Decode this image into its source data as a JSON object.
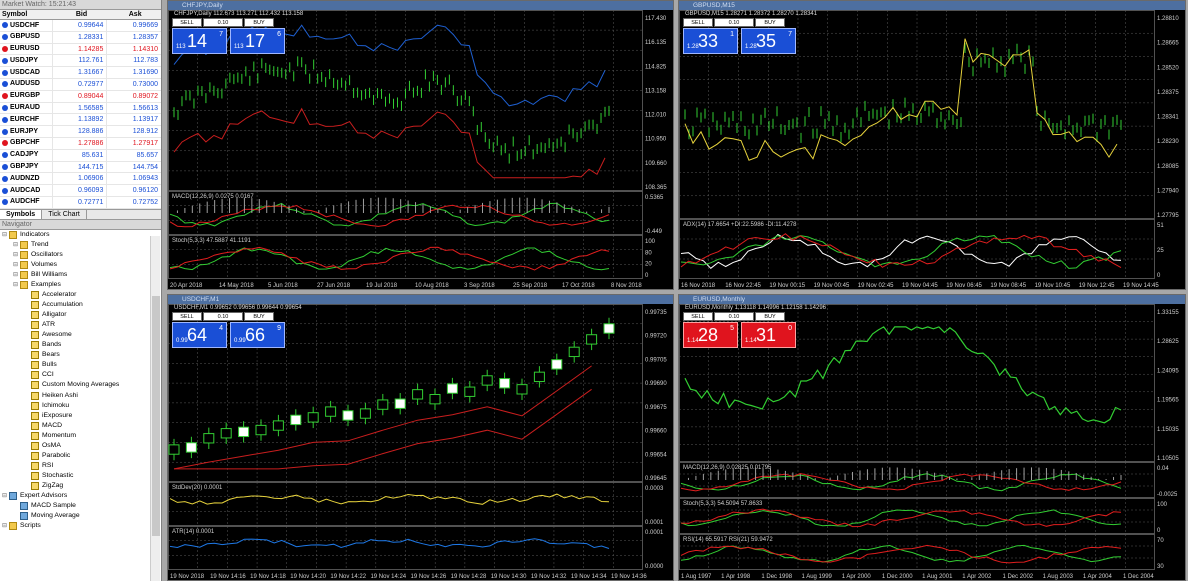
{
  "market_watch": {
    "title": "Market Watch: 15:21:43",
    "columns": [
      "Symbol",
      "Bid",
      "Ask"
    ],
    "rows": [
      {
        "s": "USDCHF",
        "b": "0.99644",
        "a": "0.99669",
        "c": "#1a4fd6"
      },
      {
        "s": "GBPUSD",
        "b": "1.28331",
        "a": "1.28357",
        "c": "#1a4fd6"
      },
      {
        "s": "EURUSD",
        "b": "1.14285",
        "a": "1.14310",
        "c": "#e0141e"
      },
      {
        "s": "USDJPY",
        "b": "112.761",
        "a": "112.783",
        "c": "#1a4fd6"
      },
      {
        "s": "USDCAD",
        "b": "1.31667",
        "a": "1.31690",
        "c": "#1a4fd6"
      },
      {
        "s": "AUDUSD",
        "b": "0.72977",
        "a": "0.73000",
        "c": "#1a4fd6"
      },
      {
        "s": "EURGBP",
        "b": "0.89044",
        "a": "0.89072",
        "c": "#e0141e"
      },
      {
        "s": "EURAUD",
        "b": "1.56585",
        "a": "1.56613",
        "c": "#1a4fd6"
      },
      {
        "s": "EURCHF",
        "b": "1.13892",
        "a": "1.13917",
        "c": "#1a4fd6"
      },
      {
        "s": "EURJPY",
        "b": "128.886",
        "a": "128.912",
        "c": "#1a4fd6"
      },
      {
        "s": "GBPCHF",
        "b": "1.27886",
        "a": "1.27917",
        "c": "#e0141e"
      },
      {
        "s": "CADJPY",
        "b": "85.631",
        "a": "85.657",
        "c": "#1a4fd6"
      },
      {
        "s": "GBPJPY",
        "b": "144.715",
        "a": "144.754",
        "c": "#1a4fd6"
      },
      {
        "s": "AUDNZD",
        "b": "1.06906",
        "a": "1.06943",
        "c": "#1a4fd6"
      },
      {
        "s": "AUDCAD",
        "b": "0.96093",
        "a": "0.96120",
        "c": "#1a4fd6"
      },
      {
        "s": "AUDCHF",
        "b": "0.72771",
        "a": "0.72752",
        "c": "#1a4fd6"
      }
    ],
    "tabs": [
      "Symbols",
      "Tick Chart"
    ]
  },
  "navigator": {
    "title": "Navigator",
    "items": [
      {
        "t": "Indicators",
        "l": 0,
        "k": "fold"
      },
      {
        "t": "Trend",
        "l": 1,
        "k": "fold"
      },
      {
        "t": "Oscillators",
        "l": 1,
        "k": "fold"
      },
      {
        "t": "Volumes",
        "l": 1,
        "k": "fold"
      },
      {
        "t": "Bill Williams",
        "l": 1,
        "k": "fold"
      },
      {
        "t": "Examples",
        "l": 1,
        "k": "fold"
      },
      {
        "t": "Accelerator",
        "l": 2,
        "k": "ind"
      },
      {
        "t": "Accumulation",
        "l": 2,
        "k": "ind"
      },
      {
        "t": "Alligator",
        "l": 2,
        "k": "ind"
      },
      {
        "t": "ATR",
        "l": 2,
        "k": "ind"
      },
      {
        "t": "Awesome",
        "l": 2,
        "k": "ind"
      },
      {
        "t": "Bands",
        "l": 2,
        "k": "ind"
      },
      {
        "t": "Bears",
        "l": 2,
        "k": "ind"
      },
      {
        "t": "Bulls",
        "l": 2,
        "k": "ind"
      },
      {
        "t": "CCI",
        "l": 2,
        "k": "ind"
      },
      {
        "t": "Custom Moving Averages",
        "l": 2,
        "k": "ind"
      },
      {
        "t": "Heiken Ashi",
        "l": 2,
        "k": "ind"
      },
      {
        "t": "Ichimoku",
        "l": 2,
        "k": "ind"
      },
      {
        "t": "iExposure",
        "l": 2,
        "k": "ind"
      },
      {
        "t": "MACD",
        "l": 2,
        "k": "ind"
      },
      {
        "t": "Momentum",
        "l": 2,
        "k": "ind"
      },
      {
        "t": "OsMA",
        "l": 2,
        "k": "ind"
      },
      {
        "t": "Parabolic",
        "l": 2,
        "k": "ind"
      },
      {
        "t": "RSI",
        "l": 2,
        "k": "ind"
      },
      {
        "t": "Stochastic",
        "l": 2,
        "k": "ind"
      },
      {
        "t": "ZigZag",
        "l": 2,
        "k": "ind"
      },
      {
        "t": "Expert Advisors",
        "l": 0,
        "k": "ea"
      },
      {
        "t": "MACD Sample",
        "l": 1,
        "k": "ea"
      },
      {
        "t": "Moving Average",
        "l": 1,
        "k": "ea"
      },
      {
        "t": "Scripts",
        "l": 0,
        "k": "fold"
      }
    ]
  },
  "charts": [
    {
      "id": "c1",
      "title": "CHFJPY,Daily",
      "ohlc": "CHFJPY,Daily 112.673 113.271 112.432 113.158",
      "trade": {
        "sell": "SELL",
        "buy": "BUY",
        "qty": "0.10",
        "sell_pre": "113",
        "sell_big": "14",
        "sell_sup": "7",
        "buy_pre": "113",
        "buy_big": "17",
        "buy_sup": "6",
        "red": false
      },
      "yticks": [
        "117.430",
        "116.135",
        "114.825",
        "113.158",
        "112.010",
        "110.950",
        "109.660",
        "108.365"
      ],
      "xticks": [
        "20 Apr 2018",
        "14 May 2018",
        "5 Jun 2018",
        "27 Jun 2018",
        "19 Jul 2018",
        "10 Aug 2018",
        "3 Sep 2018",
        "25 Sep 2018",
        "17 Oct 2018",
        "8 Nov 2018"
      ],
      "subs": [
        {
          "label": "MACD(12,26,9) 0.0275 0.0167",
          "ticks": [
            "0.5365",
            "-0.449"
          ]
        },
        {
          "label": "Stoch(5,3,3) 47.5887 41.1191",
          "ticks": [
            "100",
            "80",
            "20",
            "0"
          ]
        }
      ]
    },
    {
      "id": "c2",
      "title": "GBPUSD,M15",
      "ohlc": "GBPUSD,M15 1.28271 1.28372 1.28270 1.28341",
      "trade": {
        "sell": "SELL",
        "buy": "BUY",
        "qty": "0.10",
        "sell_pre": "1.28",
        "sell_big": "33",
        "sell_sup": "1",
        "buy_pre": "1.28",
        "buy_big": "35",
        "buy_sup": "7",
        "red": false
      },
      "yticks": [
        "1.28810",
        "1.28665",
        "1.28520",
        "1.28375",
        "1.28341",
        "1.28230",
        "1.28085",
        "1.27940",
        "1.27795"
      ],
      "xticks": [
        "16 Nov 2018",
        "16 Nov 22:45",
        "19 Nov 00:15",
        "19 Nov 00:45",
        "19 Nov 02:45",
        "19 Nov 04:45",
        "19 Nov 06:45",
        "19 Nov 08:45",
        "19 Nov 10:45",
        "19 Nov 12:45",
        "19 Nov 14:45"
      ],
      "subs": [
        {
          "label": "ADX(14) 17.6654 +DI:22.5986 -DI:11.4278",
          "ticks": [
            "51",
            "25",
            "0"
          ]
        }
      ]
    },
    {
      "id": "c3",
      "title": "USDCHF,M1",
      "ohlc": "USDCHF,M1 0.99652 0.99656 0.99644 0.99654",
      "trade": {
        "sell": "SELL",
        "buy": "BUY",
        "qty": "0.10",
        "sell_pre": "0.99",
        "sell_big": "64",
        "sell_sup": "4",
        "buy_pre": "0.99",
        "buy_big": "66",
        "buy_sup": "9",
        "red": false
      },
      "yticks": [
        "0.99735",
        "0.99720",
        "0.99705",
        "0.99690",
        "0.99675",
        "0.99660",
        "0.99654",
        "0.99645"
      ],
      "xticks": [
        "19 Nov 2018",
        "19 Nov 14:16",
        "19 Nov 14:18",
        "19 Nov 14:20",
        "19 Nov 14:22",
        "19 Nov 14:24",
        "19 Nov 14:26",
        "19 Nov 14:28",
        "19 Nov 14:30",
        "19 Nov 14:32",
        "19 Nov 14:34",
        "19 Nov 14:36"
      ],
      "subs": [
        {
          "label": "StdDev(20) 0.0001",
          "ticks": [
            "0.0003",
            "0.0001"
          ]
        },
        {
          "label": "ATR(14) 0.0001",
          "ticks": [
            "0.0001",
            "0.0000"
          ]
        }
      ]
    },
    {
      "id": "c4",
      "title": "EURUSD,Monthly",
      "ohlc": "EURUSD,Monthly 1.13118 1.14996 1.12158 1.14296",
      "trade": {
        "sell": "SELL",
        "buy": "BUY",
        "qty": "0.10",
        "sell_pre": "1.14",
        "sell_big": "28",
        "sell_sup": "5",
        "buy_pre": "1.14",
        "buy_big": "31",
        "buy_sup": "0",
        "red": true
      },
      "yticks": [
        "1.33155",
        "1.28625",
        "1.24095",
        "1.19565",
        "1.15035",
        "1.10505"
      ],
      "xticks": [
        "1 Aug 1997",
        "1 Apr 1998",
        "1 Dec 1998",
        "1 Aug 1999",
        "1 Apr 2000",
        "1 Dec 2000",
        "1 Aug 2001",
        "1 Apr 2002",
        "1 Dec 2002",
        "1 Aug 2003",
        "1 Apr 2004",
        "1 Dec 2004"
      ],
      "subs": [
        {
          "label": "MACD(12,26,9) 0.02825 0.01795",
          "ticks": [
            "0.04",
            "-0.0025"
          ]
        },
        {
          "label": "Stoch(5,3,3) 54.5094 57.8633",
          "ticks": [
            "100",
            "0"
          ]
        },
        {
          "label": "RSI(14) 65.5917 RSI(21) 59.9472",
          "ticks": [
            "70",
            "30"
          ]
        }
      ]
    }
  ]
}
